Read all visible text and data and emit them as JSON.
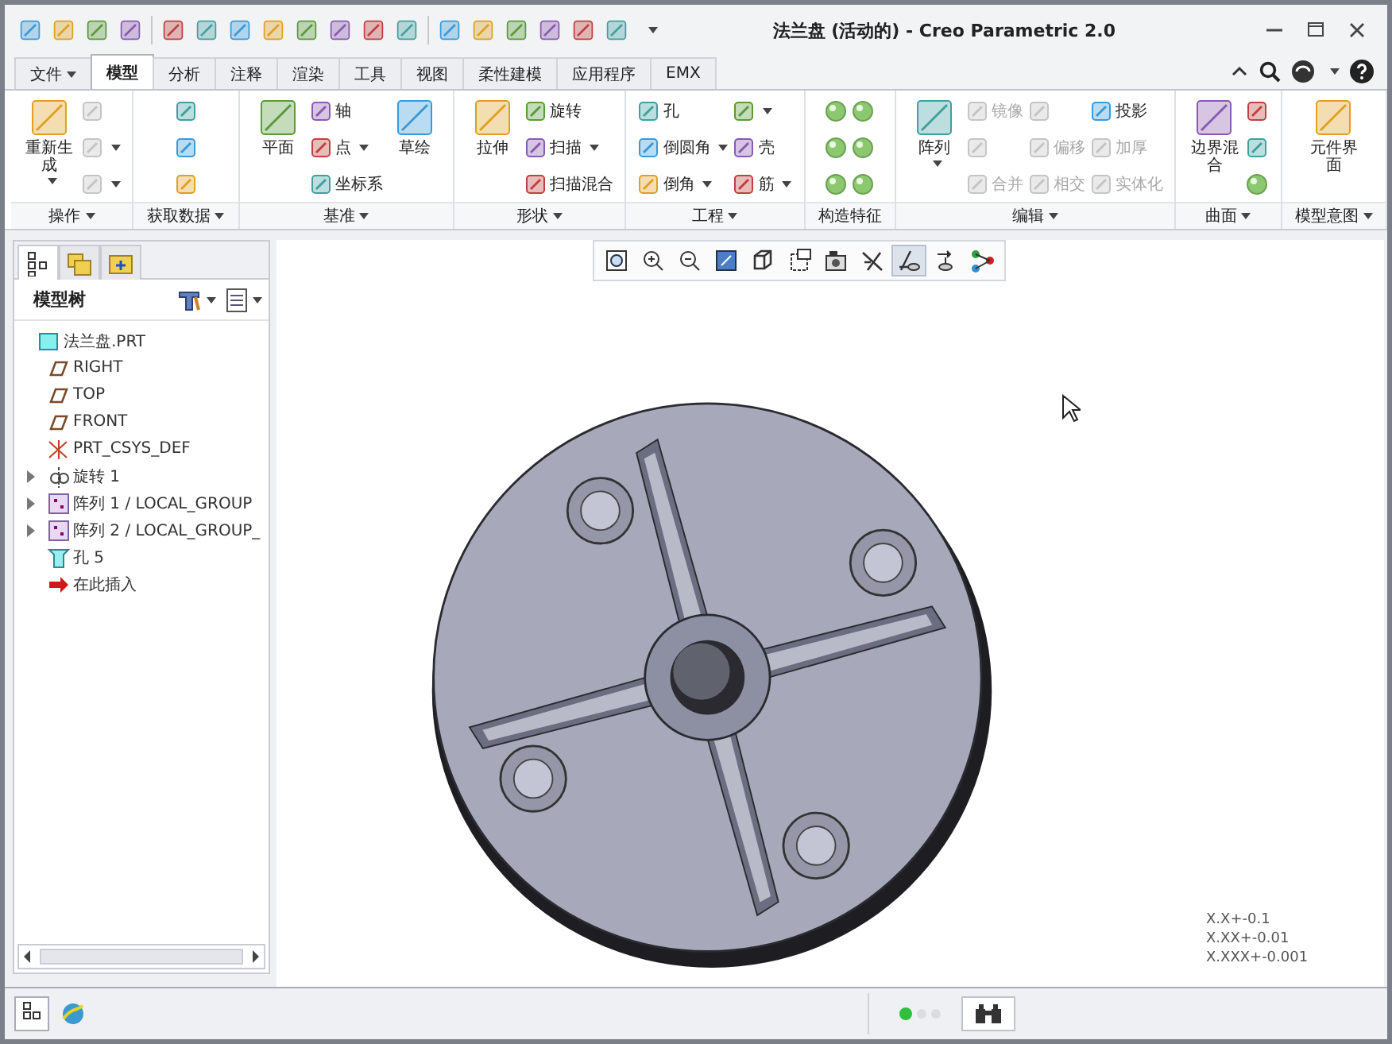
{
  "window": {
    "title": "法兰盘 (活动的) - Creo Parametric 2.0"
  },
  "tabs": [
    {
      "label": "文件",
      "selected": false,
      "dropdown": true
    },
    {
      "label": "模型",
      "selected": true,
      "dropdown": false
    },
    {
      "label": "分析",
      "selected": false,
      "dropdown": false
    },
    {
      "label": "注释",
      "selected": false,
      "dropdown": false
    },
    {
      "label": "渲染",
      "selected": false,
      "dropdown": false
    },
    {
      "label": "工具",
      "selected": false,
      "dropdown": false
    },
    {
      "label": "视图",
      "selected": false,
      "dropdown": false
    },
    {
      "label": "柔性建模",
      "selected": false,
      "dropdown": false
    },
    {
      "label": "应用程序",
      "selected": false,
      "dropdown": false
    },
    {
      "label": "EMX",
      "selected": false,
      "dropdown": false
    }
  ],
  "ribbon_groups": [
    {
      "label": "操作",
      "dropdown": true,
      "columns": [
        [
          {
            "kind": "large",
            "label": "重新生成",
            "disabled": false,
            "dropdown": true
          }
        ],
        [
          {
            "kind": "icon",
            "disabled": true,
            "dropdown": false
          },
          {
            "kind": "icon",
            "disabled": true,
            "dropdown": true
          },
          {
            "kind": "icon",
            "disabled": true,
            "dropdown": true
          }
        ]
      ]
    },
    {
      "label": "获取数据",
      "dropdown": true,
      "columns": [
        [
          {
            "kind": "icon",
            "disabled": false,
            "dropdown": false
          },
          {
            "kind": "icon",
            "disabled": false,
            "dropdown": false
          },
          {
            "kind": "icon",
            "disabled": false,
            "dropdown": false
          }
        ]
      ]
    },
    {
      "label": "基准",
      "dropdown": true,
      "columns": [
        [
          {
            "kind": "large",
            "label": "平面",
            "disabled": false,
            "dropdown": false
          }
        ],
        [
          {
            "kind": "small",
            "label": "轴",
            "disabled": false,
            "dropdown": false
          },
          {
            "kind": "small",
            "label": "点",
            "disabled": false,
            "dropdown": true
          },
          {
            "kind": "small",
            "label": "坐标系",
            "disabled": false,
            "dropdown": false
          }
        ],
        [
          {
            "kind": "large",
            "label": "草绘",
            "disabled": false,
            "dropdown": false
          }
        ]
      ]
    },
    {
      "label": "形状",
      "dropdown": true,
      "columns": [
        [
          {
            "kind": "large",
            "label": "拉伸",
            "disabled": false,
            "dropdown": false
          }
        ],
        [
          {
            "kind": "small",
            "label": "旋转",
            "disabled": false,
            "dropdown": false
          },
          {
            "kind": "small",
            "label": "扫描",
            "disabled": false,
            "dropdown": true
          },
          {
            "kind": "small",
            "label": "扫描混合",
            "disabled": false,
            "dropdown": false
          }
        ]
      ]
    },
    {
      "label": "工程",
      "dropdown": true,
      "columns": [
        [
          {
            "kind": "small",
            "label": "孔",
            "disabled": false,
            "dropdown": false
          },
          {
            "kind": "small",
            "label": "倒圆角",
            "disabled": false,
            "dropdown": true
          },
          {
            "kind": "small",
            "label": "倒角",
            "disabled": false,
            "dropdown": true
          }
        ],
        [
          {
            "kind": "icon",
            "disabled": false,
            "dropdown": true
          },
          {
            "kind": "small",
            "label": "壳",
            "disabled": false,
            "dropdown": false
          },
          {
            "kind": "small",
            "label": "筋",
            "disabled": false,
            "dropdown": true
          }
        ]
      ]
    },
    {
      "label": "构造特征",
      "dropdown": false,
      "columns": [
        [
          {
            "kind": "ball",
            "disabled": false,
            "dropdown": false
          },
          {
            "kind": "ball",
            "disabled": false,
            "dropdown": false
          },
          {
            "kind": "ball",
            "disabled": false,
            "dropdown": false
          }
        ],
        [
          {
            "kind": "ball",
            "disabled": false,
            "dropdown": false
          },
          {
            "kind": "ball",
            "disabled": false,
            "dropdown": false
          },
          {
            "kind": "ball",
            "disabled": false,
            "dropdown": false
          }
        ]
      ]
    },
    {
      "label": "编辑",
      "dropdown": true,
      "columns": [
        [
          {
            "kind": "large",
            "label": "阵列",
            "disabled": false,
            "dropdown": true
          }
        ],
        [
          {
            "kind": "small",
            "label": "镜像",
            "disabled": true,
            "dropdown": false
          },
          {
            "kind": "icon",
            "disabled": true,
            "dropdown": false
          },
          {
            "kind": "small",
            "label": "合并",
            "disabled": true,
            "dropdown": false
          }
        ],
        [
          {
            "kind": "icon",
            "disabled": true,
            "dropdown": false
          },
          {
            "kind": "small",
            "label": "偏移",
            "disabled": true,
            "dropdown": false
          },
          {
            "kind": "small",
            "label": "相交",
            "disabled": true,
            "dropdown": false
          }
        ],
        [
          {
            "kind": "small",
            "label": "投影",
            "disabled": false,
            "dropdown": false
          },
          {
            "kind": "small",
            "label": "加厚",
            "disabled": true,
            "dropdown": false
          },
          {
            "kind": "small",
            "label": "实体化",
            "disabled": true,
            "dropdown": false
          }
        ]
      ]
    },
    {
      "label": "曲面",
      "dropdown": true,
      "columns": [
        [
          {
            "kind": "large",
            "label": "边界混合",
            "disabled": false,
            "dropdown": false
          }
        ],
        [
          {
            "kind": "icon",
            "disabled": false,
            "dropdown": false
          },
          {
            "kind": "icon",
            "disabled": false,
            "dropdown": false
          },
          {
            "kind": "ball",
            "disabled": false,
            "dropdown": false
          }
        ]
      ]
    },
    {
      "label": "模型意图",
      "dropdown": true,
      "columns": [
        [
          {
            "kind": "large",
            "label": "元件界面",
            "disabled": false,
            "dropdown": false
          }
        ]
      ]
    }
  ],
  "navigator_tabs": [
    {
      "selected": true
    },
    {
      "selected": false
    },
    {
      "selected": false
    }
  ],
  "model_tree": {
    "title": "模型树",
    "items": [
      {
        "label": "法兰盘.PRT",
        "collapsed": false,
        "children": [
          {
            "label": "RIGHT",
            "collapsed": false
          },
          {
            "label": "TOP",
            "collapsed": false
          },
          {
            "label": "FRONT",
            "collapsed": false
          },
          {
            "label": "PRT_CSYS_DEF",
            "collapsed": false
          },
          {
            "label": "旋转 1",
            "collapsed": true
          },
          {
            "label": "阵列 1 / LOCAL_GROUP",
            "collapsed": true
          },
          {
            "label": "阵列 2 / LOCAL_GROUP_",
            "collapsed": true
          },
          {
            "label": "孔 5",
            "collapsed": false
          },
          {
            "label": "在此插入",
            "collapsed": false
          }
        ]
      }
    ]
  },
  "view_toolbar": [
    {
      "selected": false
    },
    {
      "selected": false
    },
    {
      "selected": false
    },
    {
      "selected": false
    },
    {
      "selected": false
    },
    {
      "selected": false
    },
    {
      "selected": false
    },
    {
      "selected": false
    },
    {
      "selected": true
    },
    {
      "selected": false
    },
    {
      "selected": false
    }
  ],
  "tolerance_notes": [
    "X.X+-0.1",
    "X.XX+-0.01",
    "X.XXX+-0.001"
  ]
}
